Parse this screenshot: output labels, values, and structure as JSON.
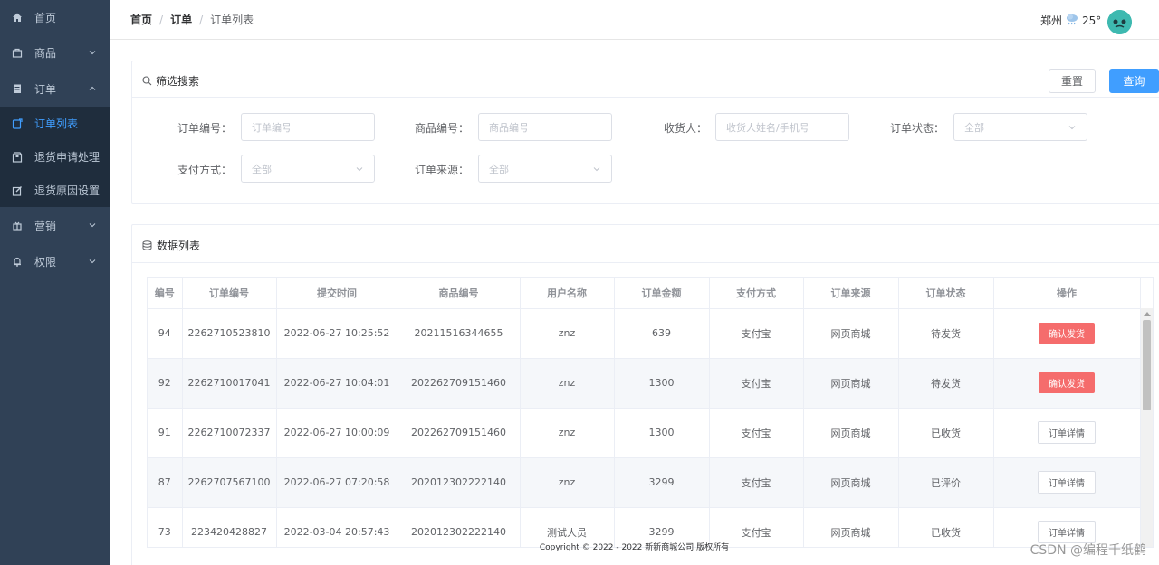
{
  "sidebar": {
    "items": [
      {
        "label": "首页",
        "icon": "home-icon"
      },
      {
        "label": "商品",
        "icon": "bag-icon"
      },
      {
        "label": "订单",
        "icon": "clipboard-icon"
      },
      {
        "label": "订单列表",
        "icon": "list-icon"
      },
      {
        "label": "退货申请处理",
        "icon": "box-icon"
      },
      {
        "label": "退货原因设置",
        "icon": "edit-icon"
      },
      {
        "label": "营销",
        "icon": "gift-icon"
      },
      {
        "label": "权限",
        "icon": "bell-icon"
      }
    ]
  },
  "header": {
    "breadcrumb": [
      "首页",
      "订单",
      "订单列表"
    ],
    "weather_city": "郑州",
    "weather_temp": "25°"
  },
  "filter": {
    "title": "筛选搜索",
    "reset_label": "重置",
    "query_label": "查询",
    "fields": [
      {
        "label": "订单编号：",
        "placeholder": "订单编号"
      },
      {
        "label": "商品编号：",
        "placeholder": "商品编号"
      },
      {
        "label": "收货人：",
        "placeholder": "收货人姓名/手机号"
      },
      {
        "label": "订单状态：",
        "placeholder": "全部"
      },
      {
        "label": "支付方式：",
        "placeholder": "全部"
      },
      {
        "label": "订单来源：",
        "placeholder": "全部"
      }
    ]
  },
  "list": {
    "title": "数据列表",
    "columns": [
      "编号",
      "订单编号",
      "提交时间",
      "商品编号",
      "用户名称",
      "订单金额",
      "支付方式",
      "订单来源",
      "订单状态",
      "操作"
    ],
    "rows": [
      [
        "94",
        "2262710523810",
        "2022-06-27 10:25:52",
        "20211516344655",
        "znz",
        "639",
        "支付宝",
        "网页商城",
        "待发货",
        "确认发货"
      ],
      [
        "92",
        "2262710017041",
        "2022-06-27 10:04:01",
        "202262709151460",
        "znz",
        "1300",
        "支付宝",
        "网页商城",
        "待发货",
        "确认发货"
      ],
      [
        "91",
        "2262710072337",
        "2022-06-27 10:00:09",
        "202262709151460",
        "znz",
        "1300",
        "支付宝",
        "网页商城",
        "已收货",
        "订单详情"
      ],
      [
        "87",
        "2262707567100",
        "2022-06-27 07:20:58",
        "202012302222140",
        "znz",
        "3299",
        "支付宝",
        "网页商城",
        "已评价",
        "订单详情"
      ],
      [
        "73",
        "223420428827",
        "2022-03-04 20:57:43",
        "202012302222140",
        "测试人员",
        "3299",
        "支付宝",
        "网页商城",
        "已收货",
        "订单详情"
      ]
    ]
  },
  "footer": {
    "text": "Copyright © 2022 - 2022 新新商城公司 版权所有"
  },
  "watermark": "CSDN @编程千纸鹤",
  "colors": {
    "sidebar_bg": "#304156",
    "submenu_bg": "#1f2d3d",
    "primary": "#409eff",
    "danger": "#f56c6c"
  }
}
